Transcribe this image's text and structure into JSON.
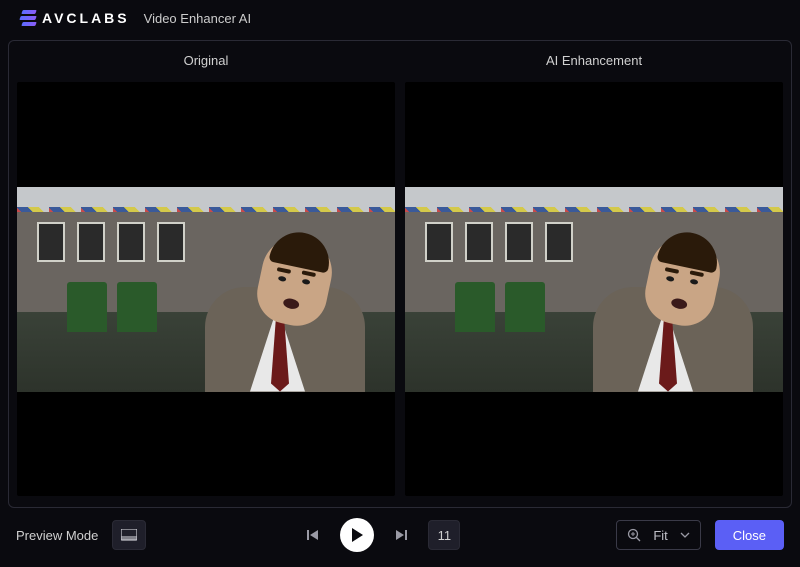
{
  "header": {
    "brand": "AVCLABS",
    "app_title": "Video Enhancer AI"
  },
  "preview": {
    "original_label": "Original",
    "enhanced_label": "AI Enhancement"
  },
  "controls": {
    "preview_mode_label": "Preview Mode",
    "frame_number": "11",
    "zoom_label": "Fit",
    "close_label": "Close"
  }
}
